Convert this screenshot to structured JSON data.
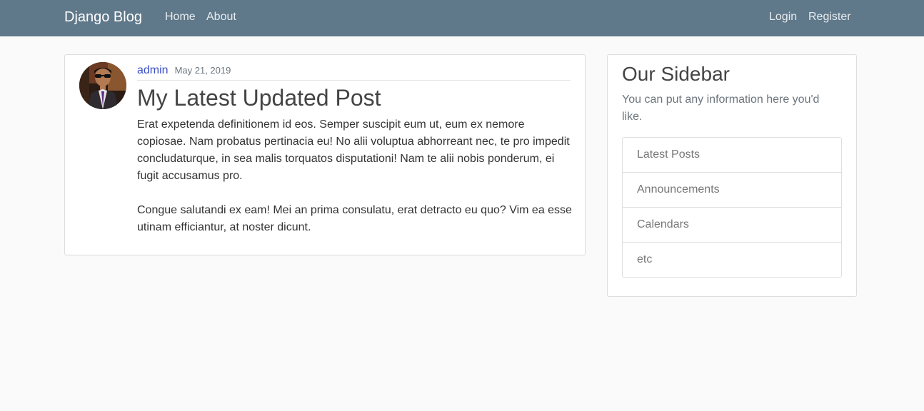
{
  "navbar": {
    "brand": "Django Blog",
    "left_links": [
      "Home",
      "About"
    ],
    "right_links": [
      "Login",
      "Register"
    ],
    "background": "#5f788a"
  },
  "post": {
    "author": "admin",
    "date": "May 21, 2019",
    "title": "My Latest Updated Post",
    "paragraphs": [
      "Erat expetenda definitionem id eos. Semper suscipit eum ut, eum ex nemore copiosae. Nam probatus pertinacia eu! No alii voluptua abhorreant nec, te pro impedit concludaturque, in sea malis torquatos disputationi! Nam te alii nobis ponderum, ei fugit accusamus pro.",
      "Congue salutandi ex eam! Mei an prima consulatu, erat detracto eu quo? Vim ea esse utinam efficiantur, at noster dicunt."
    ],
    "avatar_icon": "user-avatar-photo"
  },
  "sidebar": {
    "title": "Our Sidebar",
    "text": "You can put any information here you'd like.",
    "items": [
      "Latest Posts",
      "Announcements",
      "Calendars",
      "etc"
    ]
  },
  "colors": {
    "link": "#3b4fc8",
    "muted": "#6c757d",
    "page_background": "#fafafa"
  }
}
